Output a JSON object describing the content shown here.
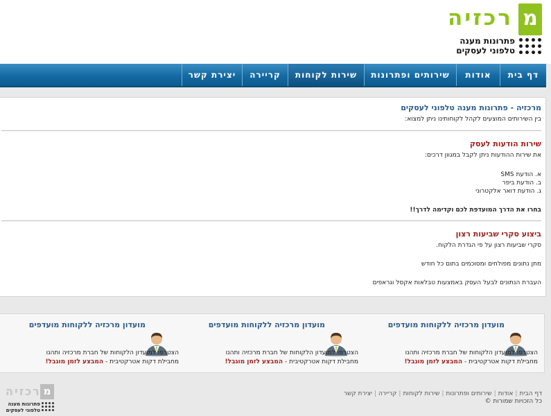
{
  "header": {
    "logo_letter": "מ",
    "logo_name": "רכזיה",
    "tagline_1": "פתרונות מענה",
    "tagline_2": "טלפוני לעסקים"
  },
  "nav": {
    "items": [
      {
        "label": "דף בית"
      },
      {
        "label": "אודות"
      },
      {
        "label": "שירותים ופתרונות"
      },
      {
        "label": "שירות לקוחות"
      },
      {
        "label": "קריירה"
      },
      {
        "label": "יצירת קשר"
      }
    ],
    "active_index": 3
  },
  "main": {
    "intro_title": "מרכזיה - פתרונות מענה טלפוני לעסקים",
    "intro_text": "בין השירותים המוצעים לקהל לקוחותינו ניתן למצוא:",
    "messages": {
      "title": "שירות הודעות לעסק",
      "text": "את שירות ההודעות ניתן לקבל במגוון דרכים:",
      "list": [
        "א. הודעת SMS",
        "ב. הודעת ביפר",
        "ג. הודעת דואר אלקטרוני"
      ],
      "cta": "בחרו את הדרך המועדפת לכם וקדימה לדרך!!"
    },
    "surveys": {
      "title": "ביצוע סקרי שביעות רצון",
      "line_1": "סקרי שביעות רצון על פי הגדרת הלקוח.",
      "line_2": "מתן נתונים מפולחים ומסוכמים בתום כל חודש",
      "line_3": "העברת הנתונים לבעל העסק באמצעות טבלאות אקסל וגראפים"
    }
  },
  "clubs": [
    {
      "title": "מועדון מרכזיה ללקוחות מועדפים",
      "desc_1": "הצטרפו למועדון הלקוחות של חברת מרכזיה ותהנו",
      "desc_2": "מחבילת דקות אטרקטיבית - ",
      "promo": "המבצע לזמן מוגבל!"
    },
    {
      "title": "מועדון מרכזיה ללקוחות מועדפים",
      "desc_1": "הצטרפו למועדון הלקוחות של חברת מרכזיה ותהנו",
      "desc_2": "מחבילת דקות אטרקטיבית - ",
      "promo": "המבצע לזמן מוגבל!"
    },
    {
      "title": "מועדון מרכזיה ללקוחות מועדפים",
      "desc_1": "הצטרפו למועדון הלקוחות של חברת מרכזיה ותהנו",
      "desc_2": "מחבילת דקות אטרקטיבית - ",
      "promo": "המבצע לזמן מוגבל!"
    }
  ],
  "footer": {
    "links": [
      "דף הבית",
      "אודות",
      "שירותים ופתרונות",
      "שירות לקוחות",
      "קריירה",
      "יצירת קשר"
    ],
    "copyright": "כל הזכויות שמורות ©",
    "logo_letter": "מ",
    "logo_name": "רכזיה",
    "tagline_1": "פתרונות מענה",
    "tagline_2": "טלפוני לעסקים"
  },
  "colors": {
    "brand_green": "#8fc21f",
    "nav_blue": "#146aa3",
    "title_blue": "#2a5a8a",
    "title_red": "#a0201c",
    "cta_green": "#6a9b14"
  },
  "icons": {
    "club_avatar": "businessman-avatar-icon",
    "logo_dots": "keypad-dots-icon"
  }
}
